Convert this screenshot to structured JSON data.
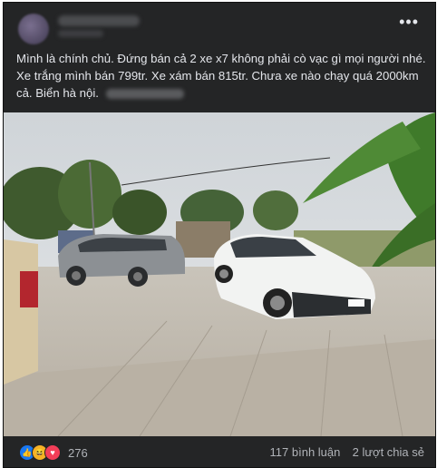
{
  "post": {
    "text": "Mình là chính chủ. Đứng bán cả 2 xe x7 không phải cò vạc gì mọi người nhé. Xe trắng mình bán 799tr. Xe xám bán 815tr. Chưa xe nào chạy quá 2000km cả. Biển hà nội.",
    "more_icon": "more-horizontal-icon"
  },
  "photo": {
    "sky_color": "#d9dde0",
    "white_car_color": "#f2f3f2",
    "gray_car_color": "#8c9094"
  },
  "footer": {
    "reaction_icons": [
      "like-icon",
      "haha-icon",
      "love-icon"
    ],
    "reaction_count": "276",
    "comments": "117 bình luận",
    "shares": "2 lượt chia sẻ"
  },
  "colors": {
    "background": "#242526",
    "text": "#e4e6eb",
    "secondary_text": "#b0b3b8",
    "like_blue": "#1877f2",
    "love_red": "#f33e58"
  }
}
